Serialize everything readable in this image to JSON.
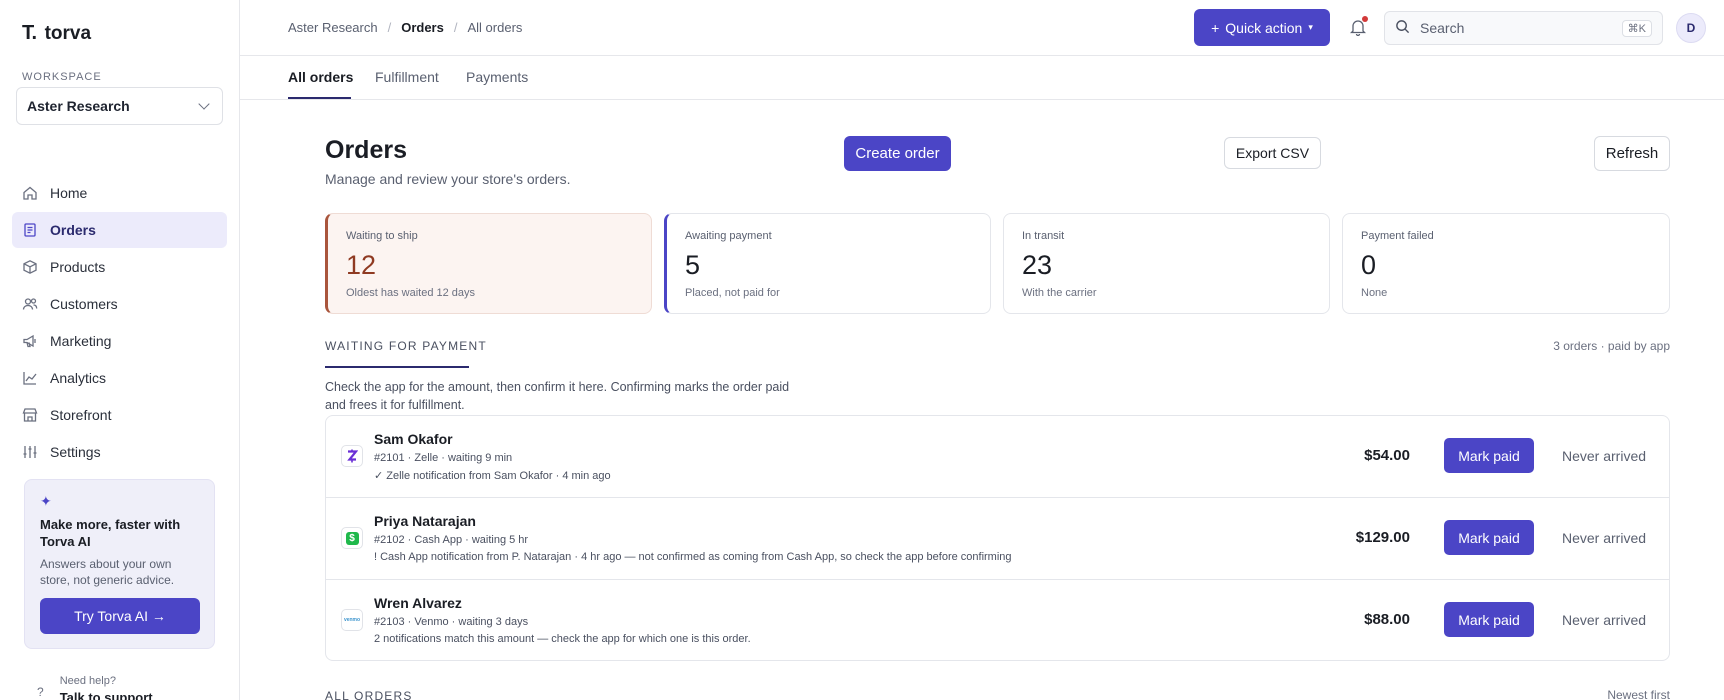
{
  "brand": {
    "mark": "T.",
    "name": "torva"
  },
  "workspace": {
    "label": "WORKSPACE",
    "selected": "Aster Research"
  },
  "nav": [
    {
      "label": "Home",
      "icon": "home-icon"
    },
    {
      "label": "Orders",
      "icon": "orders-icon",
      "active": true
    },
    {
      "label": "Products",
      "icon": "box-icon"
    },
    {
      "label": "Customers",
      "icon": "users-icon"
    },
    {
      "label": "Marketing",
      "icon": "megaphone-icon"
    },
    {
      "label": "Analytics",
      "icon": "chart-icon"
    },
    {
      "label": "Storefront",
      "icon": "store-icon"
    },
    {
      "label": "Settings",
      "icon": "sliders-icon"
    }
  ],
  "promo": {
    "title": "Make more, faster with Torva AI",
    "text": "Answers about your own store, not generic advice.",
    "button": "Try Torva AI →"
  },
  "help": {
    "line1": "Need help?",
    "line2": "Talk to support",
    "icon_text": "?"
  },
  "breadcrumb": {
    "root": "Aster Research",
    "section": "Orders",
    "current": "All orders",
    "separator": "/"
  },
  "header": {
    "quick_action": "Quick action",
    "quick_action_prefix": "+",
    "search_placeholder": "Search",
    "search_shortcut": "⌘K",
    "avatar_initial": "D"
  },
  "tabs": [
    "All orders",
    "Fulfillment",
    "Payments"
  ],
  "page": {
    "title": "Orders",
    "subtitle": "Manage and review your store's orders.",
    "create_button": "Create order",
    "export_button": "Export CSV",
    "refresh_button": "Refresh"
  },
  "stats": [
    {
      "label": "Waiting to ship",
      "value": "12",
      "note": "Oldest has waited 12 days"
    },
    {
      "label": "Awaiting payment",
      "value": "5",
      "note": "Placed, not paid for"
    },
    {
      "label": "In transit",
      "value": "23",
      "note": "With the carrier"
    },
    {
      "label": "Payment failed",
      "value": "0",
      "note": "None"
    }
  ],
  "waiting": {
    "heading": "WAITING FOR PAYMENT",
    "meta": "3 orders · paid by app",
    "description": "Check the app for the amount, then confirm it here. Confirming marks the order paid and frees it for fulfillment.",
    "rows": [
      {
        "name": "Sam Okafor",
        "meta": "#2101 · Zelle · waiting 9 min",
        "note": "✓ Zelle notification from Sam Okafor · 4 min ago",
        "amount": "$54.00",
        "app_glyph": "Z",
        "app_color": "#6a2fd6",
        "mark_label": "Mark paid",
        "never_label": "Never arrived"
      },
      {
        "name": "Priya Natarajan",
        "meta": "#2102 · Cash App · waiting 5 hr",
        "note": "! Cash App notification from P. Natarajan · 4 hr ago — not confirmed as coming from Cash App, so check the app before confirming",
        "amount": "$129.00",
        "app_glyph": "$",
        "app_color": "#1fb84b",
        "mark_label": "Mark paid",
        "never_label": "Never arrived"
      },
      {
        "name": "Wren Alvarez",
        "meta": "#2103 · Venmo · waiting 3 days",
        "note": "2 notifications match this amount — check the app for which one is this order.",
        "amount": "$88.00",
        "app_glyph": "venmo",
        "app_color": "#3d95ce",
        "mark_label": "Mark paid",
        "never_label": "Never arrived"
      }
    ]
  },
  "all_orders": {
    "heading": "ALL ORDERS",
    "sort": "Newest first"
  },
  "colors": {
    "accent": "#4b45c6",
    "warn": "#a9553c",
    "notification_dot": "#d23a3a"
  }
}
